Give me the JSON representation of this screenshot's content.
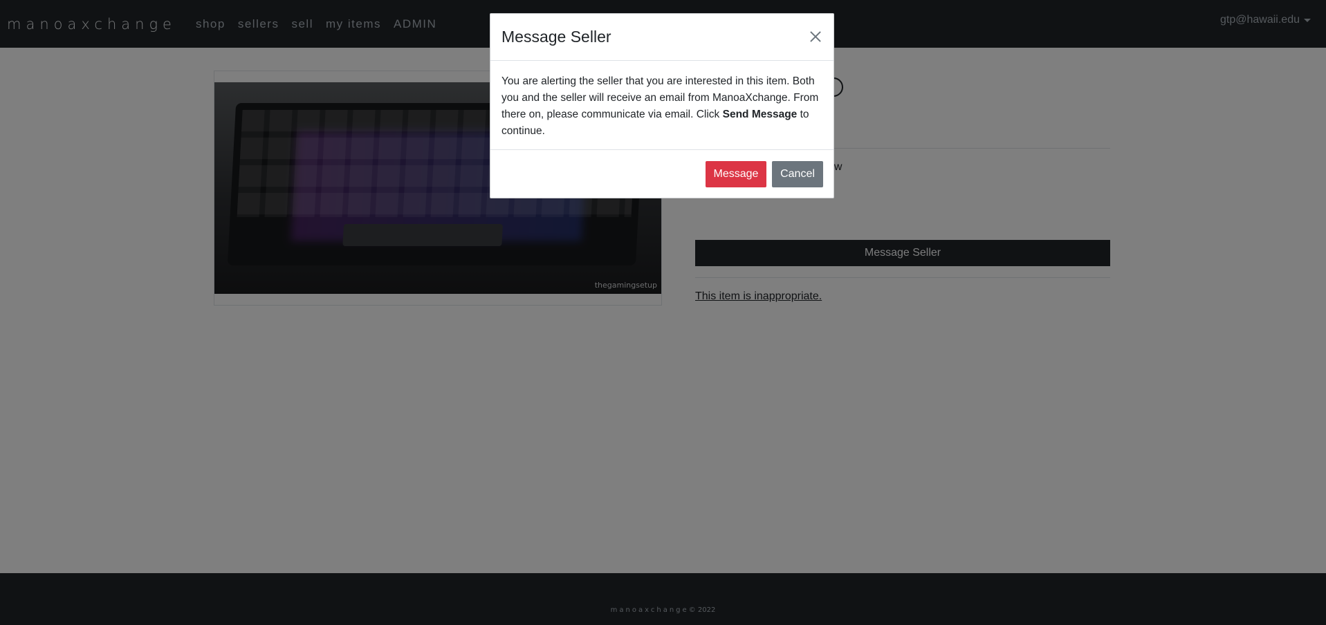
{
  "navbar": {
    "brand": "manoaxchange",
    "links": [
      "shop",
      "sellers",
      "sell",
      "my items",
      "ADMIN"
    ],
    "user_email": "gtp@hawaii.edu"
  },
  "product": {
    "image_watermark": "thegamingsetup",
    "condition_partial": "ew",
    "message_seller_label": "Message Seller",
    "report_link": "This item is inappropriate."
  },
  "modal": {
    "title": "Message Seller",
    "body_part1": "You are alerting the seller that you are interested in this item. Both you and the seller will receive an email from ManoaXchange. From there on, please communicate via email. Click ",
    "body_bold": "Send Message",
    "body_part2": " to continue.",
    "message_button": "Message",
    "cancel_button": "Cancel"
  },
  "footer": {
    "brand": "manoaxchange",
    "copyright": "© 2022"
  },
  "colors": {
    "navbar_bg": "#212529",
    "danger": "#dc3545",
    "secondary": "#6c757d"
  }
}
